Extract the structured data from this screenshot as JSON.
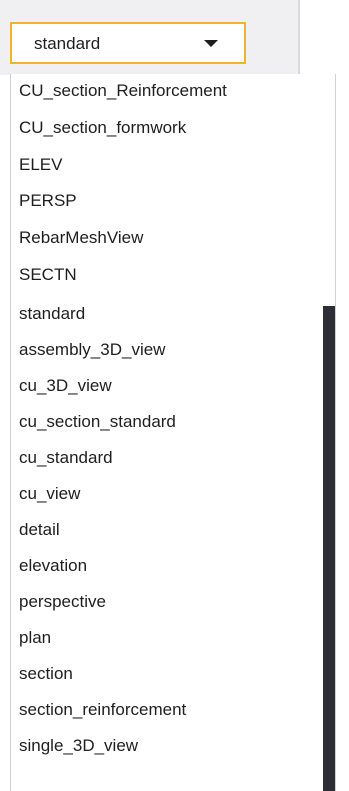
{
  "combo": {
    "selected_value": "standard",
    "arrow_icon": "chevron-down-icon"
  },
  "dropdown": {
    "items": [
      "CU_section_Reinforcement",
      "CU_section_formwork",
      "ELEV",
      "PERSP",
      "RebarMeshView",
      "SECTN",
      "standard",
      "assembly_3D_view",
      "cu_3D_view",
      "cu_section_standard",
      "cu_standard",
      "cu_view",
      "detail",
      "elevation",
      "perspective",
      "plan",
      "section",
      "section_reinforcement",
      "single_3D_view"
    ]
  },
  "colors": {
    "combo_border": "#f0b32e",
    "scrollbar_thumb": "#2d2d35",
    "text": "#1e1e1e"
  }
}
